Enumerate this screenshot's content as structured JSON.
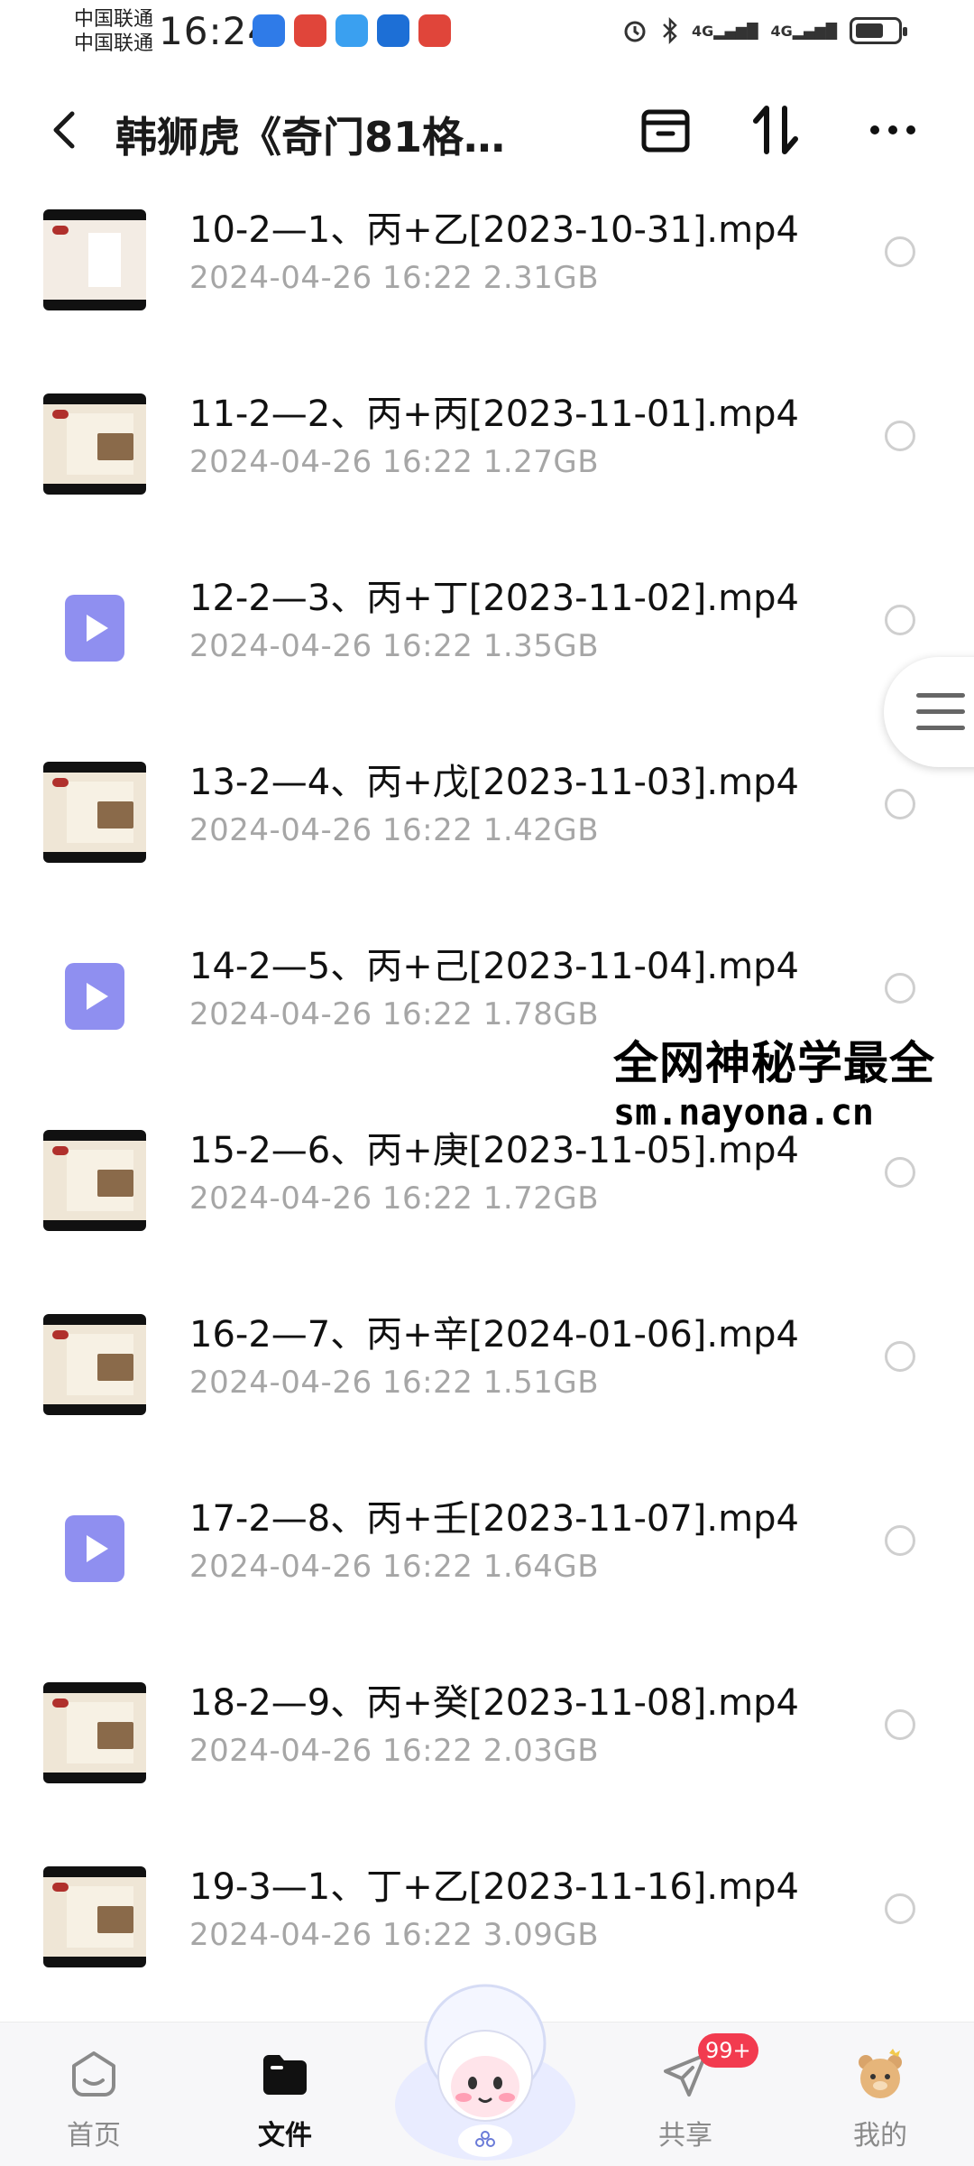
{
  "status_bar": {
    "carrier1": "中国联通",
    "carrier2": "中国联通",
    "time": "16:24",
    "network": "4G"
  },
  "header": {
    "title": "韩狮虎《奇门81格…"
  },
  "files": [
    {
      "name": "10-2—1、丙+乙[2023-10-31].mp4",
      "date": "2024-04-26  16:22",
      "size": "2.31GB",
      "thumb": "cover"
    },
    {
      "name": "11-2—2、丙+丙[2023-11-01].mp4",
      "date": "2024-04-26  16:22",
      "size": "1.27GB",
      "thumb": "slide"
    },
    {
      "name": "12-2—3、丙+丁[2023-11-02].mp4",
      "date": "2024-04-26  16:22",
      "size": "1.35GB",
      "thumb": "video"
    },
    {
      "name": "13-2—4、丙+戊[2023-11-03].mp4",
      "date": "2024-04-26  16:22",
      "size": "1.42GB",
      "thumb": "slide"
    },
    {
      "name": "14-2—5、丙+己[2023-11-04].mp4",
      "date": "2024-04-26  16:22",
      "size": "1.78GB",
      "thumb": "video"
    },
    {
      "name": "15-2—6、丙+庚[2023-11-05].mp4",
      "date": "2024-04-26  16:22",
      "size": "1.72GB",
      "thumb": "slide"
    },
    {
      "name": "16-2—7、丙+辛[2024-01-06].mp4",
      "date": "2024-04-26  16:22",
      "size": "1.51GB",
      "thumb": "slide"
    },
    {
      "name": "17-2—8、丙+壬[2023-11-07].mp4",
      "date": "2024-04-26  16:22",
      "size": "1.64GB",
      "thumb": "video"
    },
    {
      "name": "18-2—9、丙+癸[2023-11-08].mp4",
      "date": "2024-04-26  16:22",
      "size": "2.03GB",
      "thumb": "slide"
    },
    {
      "name": "19-3—1、丁+乙[2023-11-16].mp4",
      "date": "2024-04-26  16:22",
      "size": "3.09GB",
      "thumb": "slide"
    }
  ],
  "watermark": {
    "line1": "全网神秘学最全",
    "line2": "sm.nayona.cn"
  },
  "nav": {
    "home": "首页",
    "files": "文件",
    "share": "共享",
    "mine": "我的",
    "share_badge": "99+"
  },
  "colors": {
    "video_icon": "#8f8ff0",
    "badge": "#f23b4f",
    "meta_text": "#a6a6a6"
  }
}
